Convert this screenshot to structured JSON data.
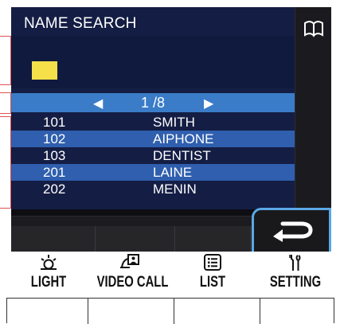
{
  "header": {
    "title": "NAME SEARCH",
    "icon": "book-icon"
  },
  "input": {
    "value": "",
    "cursor_color": "#f5e04a"
  },
  "pager": {
    "current": "1",
    "text": "1 /8",
    "prev_icon": "◀",
    "next_icon": "▶"
  },
  "entries": [
    {
      "number": "101",
      "name": "SMITH",
      "highlighted": false
    },
    {
      "number": "102",
      "name": "AIPHONE",
      "highlighted": true
    },
    {
      "number": "103",
      "name": "DENTIST",
      "highlighted": false
    },
    {
      "number": "201",
      "name": "LAINE",
      "highlighted": true
    },
    {
      "number": "202",
      "name": "MENIN",
      "highlighted": false
    }
  ],
  "softkeys": {
    "back_icon": "return-arrow-icon"
  },
  "hardware_buttons": [
    {
      "label": "LIGHT",
      "icon": "light-icon"
    },
    {
      "label": "VIDEO CALL",
      "icon": "video-call-icon"
    },
    {
      "label": "LIST",
      "icon": "list-icon"
    },
    {
      "label": "SETTING",
      "icon": "setting-icon"
    }
  ],
  "colors": {
    "screen_bg": "#141d44",
    "highlight": "#2f5fae",
    "pager": "#3a7cc8",
    "accent": "#5aa8e6"
  }
}
